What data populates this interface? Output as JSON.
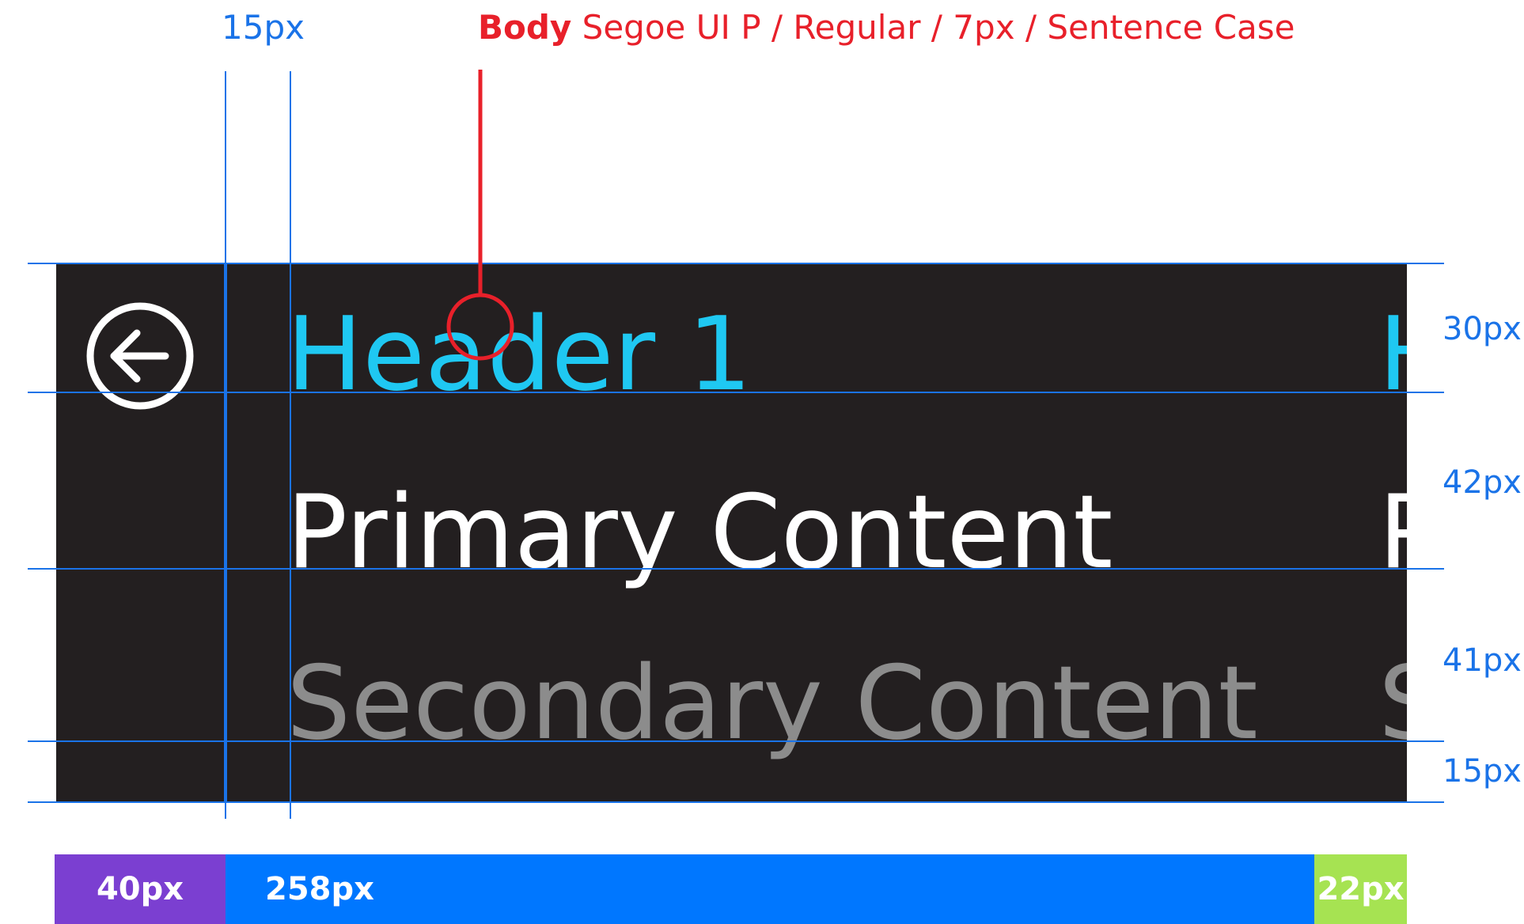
{
  "annotations": {
    "top_measure": "15px",
    "body_label_bold": "Body",
    "body_label_rest": " Segoe UI P / Regular / 7px / Sentence Case"
  },
  "panel": {
    "header1": "Header 1",
    "primary": "Primary Content",
    "secondary": "Secondary Content",
    "edge_header": "H",
    "edge_primary": "P",
    "edge_secondary": "S",
    "back_icon": "back-arrow-circle-icon"
  },
  "side_measures": [
    "30px",
    "42px",
    "41px",
    "15px"
  ],
  "legend": [
    {
      "label": "40px",
      "color": "#7b3fd1"
    },
    {
      "label": "258px",
      "color": "#0077ff"
    },
    {
      "label": "22px",
      "color": "#a6e352"
    }
  ],
  "colors": {
    "panel_bg": "#231f20",
    "header_text": "#1fc8f2",
    "primary_text": "#ffffff",
    "secondary_text": "#8c8c8c",
    "guide_blue": "#1a73e8",
    "annotation_red": "#e8202a"
  }
}
